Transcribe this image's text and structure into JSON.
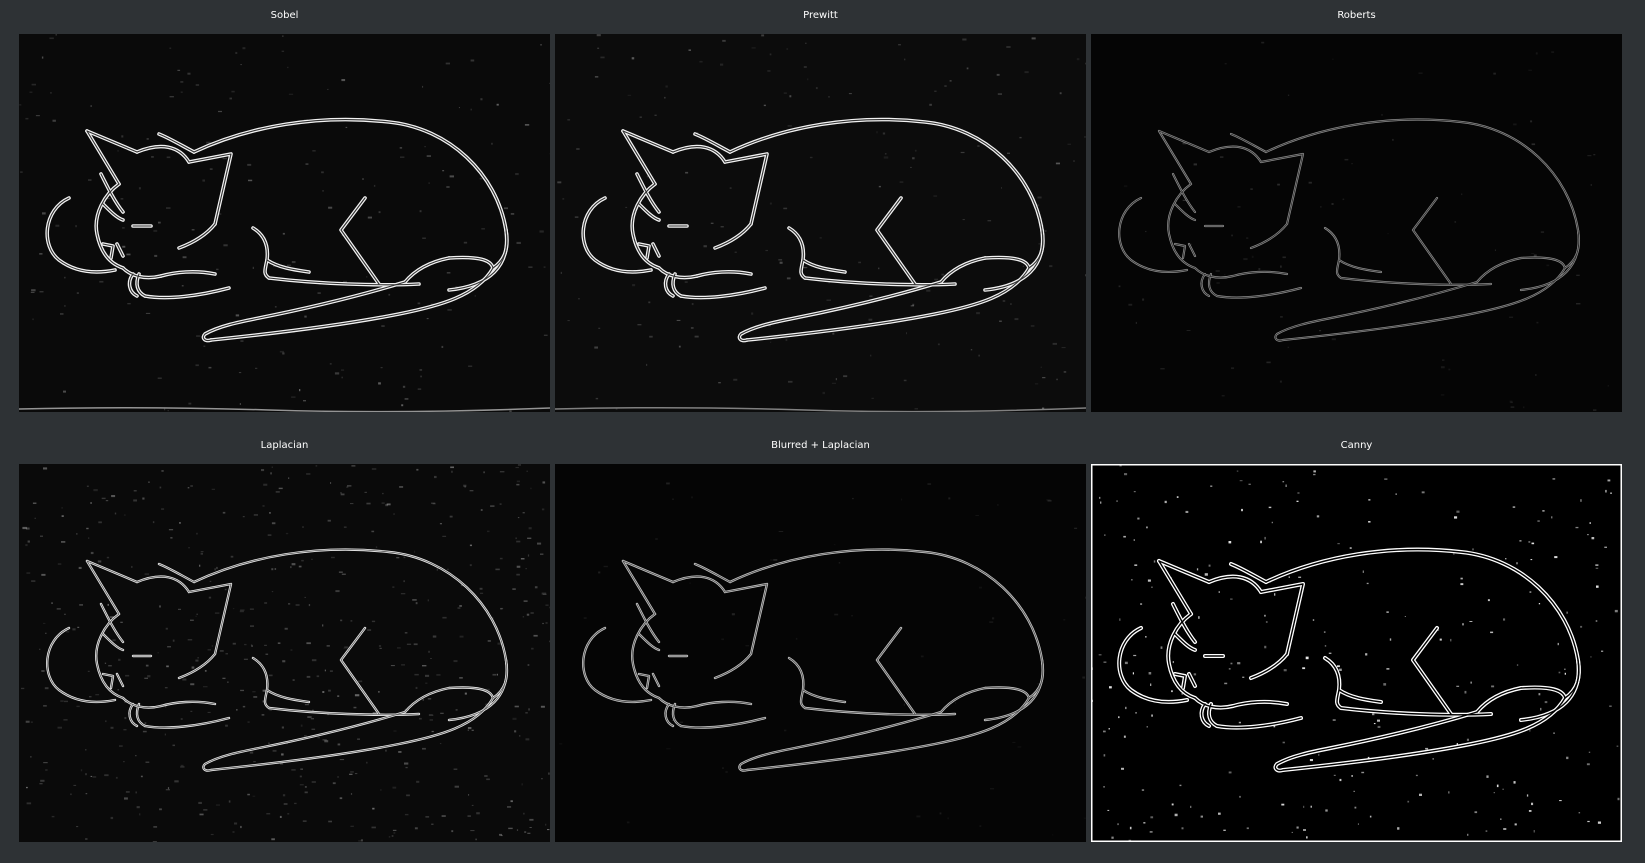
{
  "panels": [
    {
      "title": "Sobel",
      "style": "sobel"
    },
    {
      "title": "Prewitt",
      "style": "prewitt"
    },
    {
      "title": "Roberts",
      "style": "roberts"
    },
    {
      "title": "Laplacian",
      "style": "laplacian"
    },
    {
      "title": "Blurred + Laplacian",
      "style": "blurlap"
    },
    {
      "title": "Canny",
      "style": "canny"
    }
  ],
  "colors": {
    "background": "#2e3235",
    "panel": "#000000",
    "edge": "#ffffff"
  }
}
